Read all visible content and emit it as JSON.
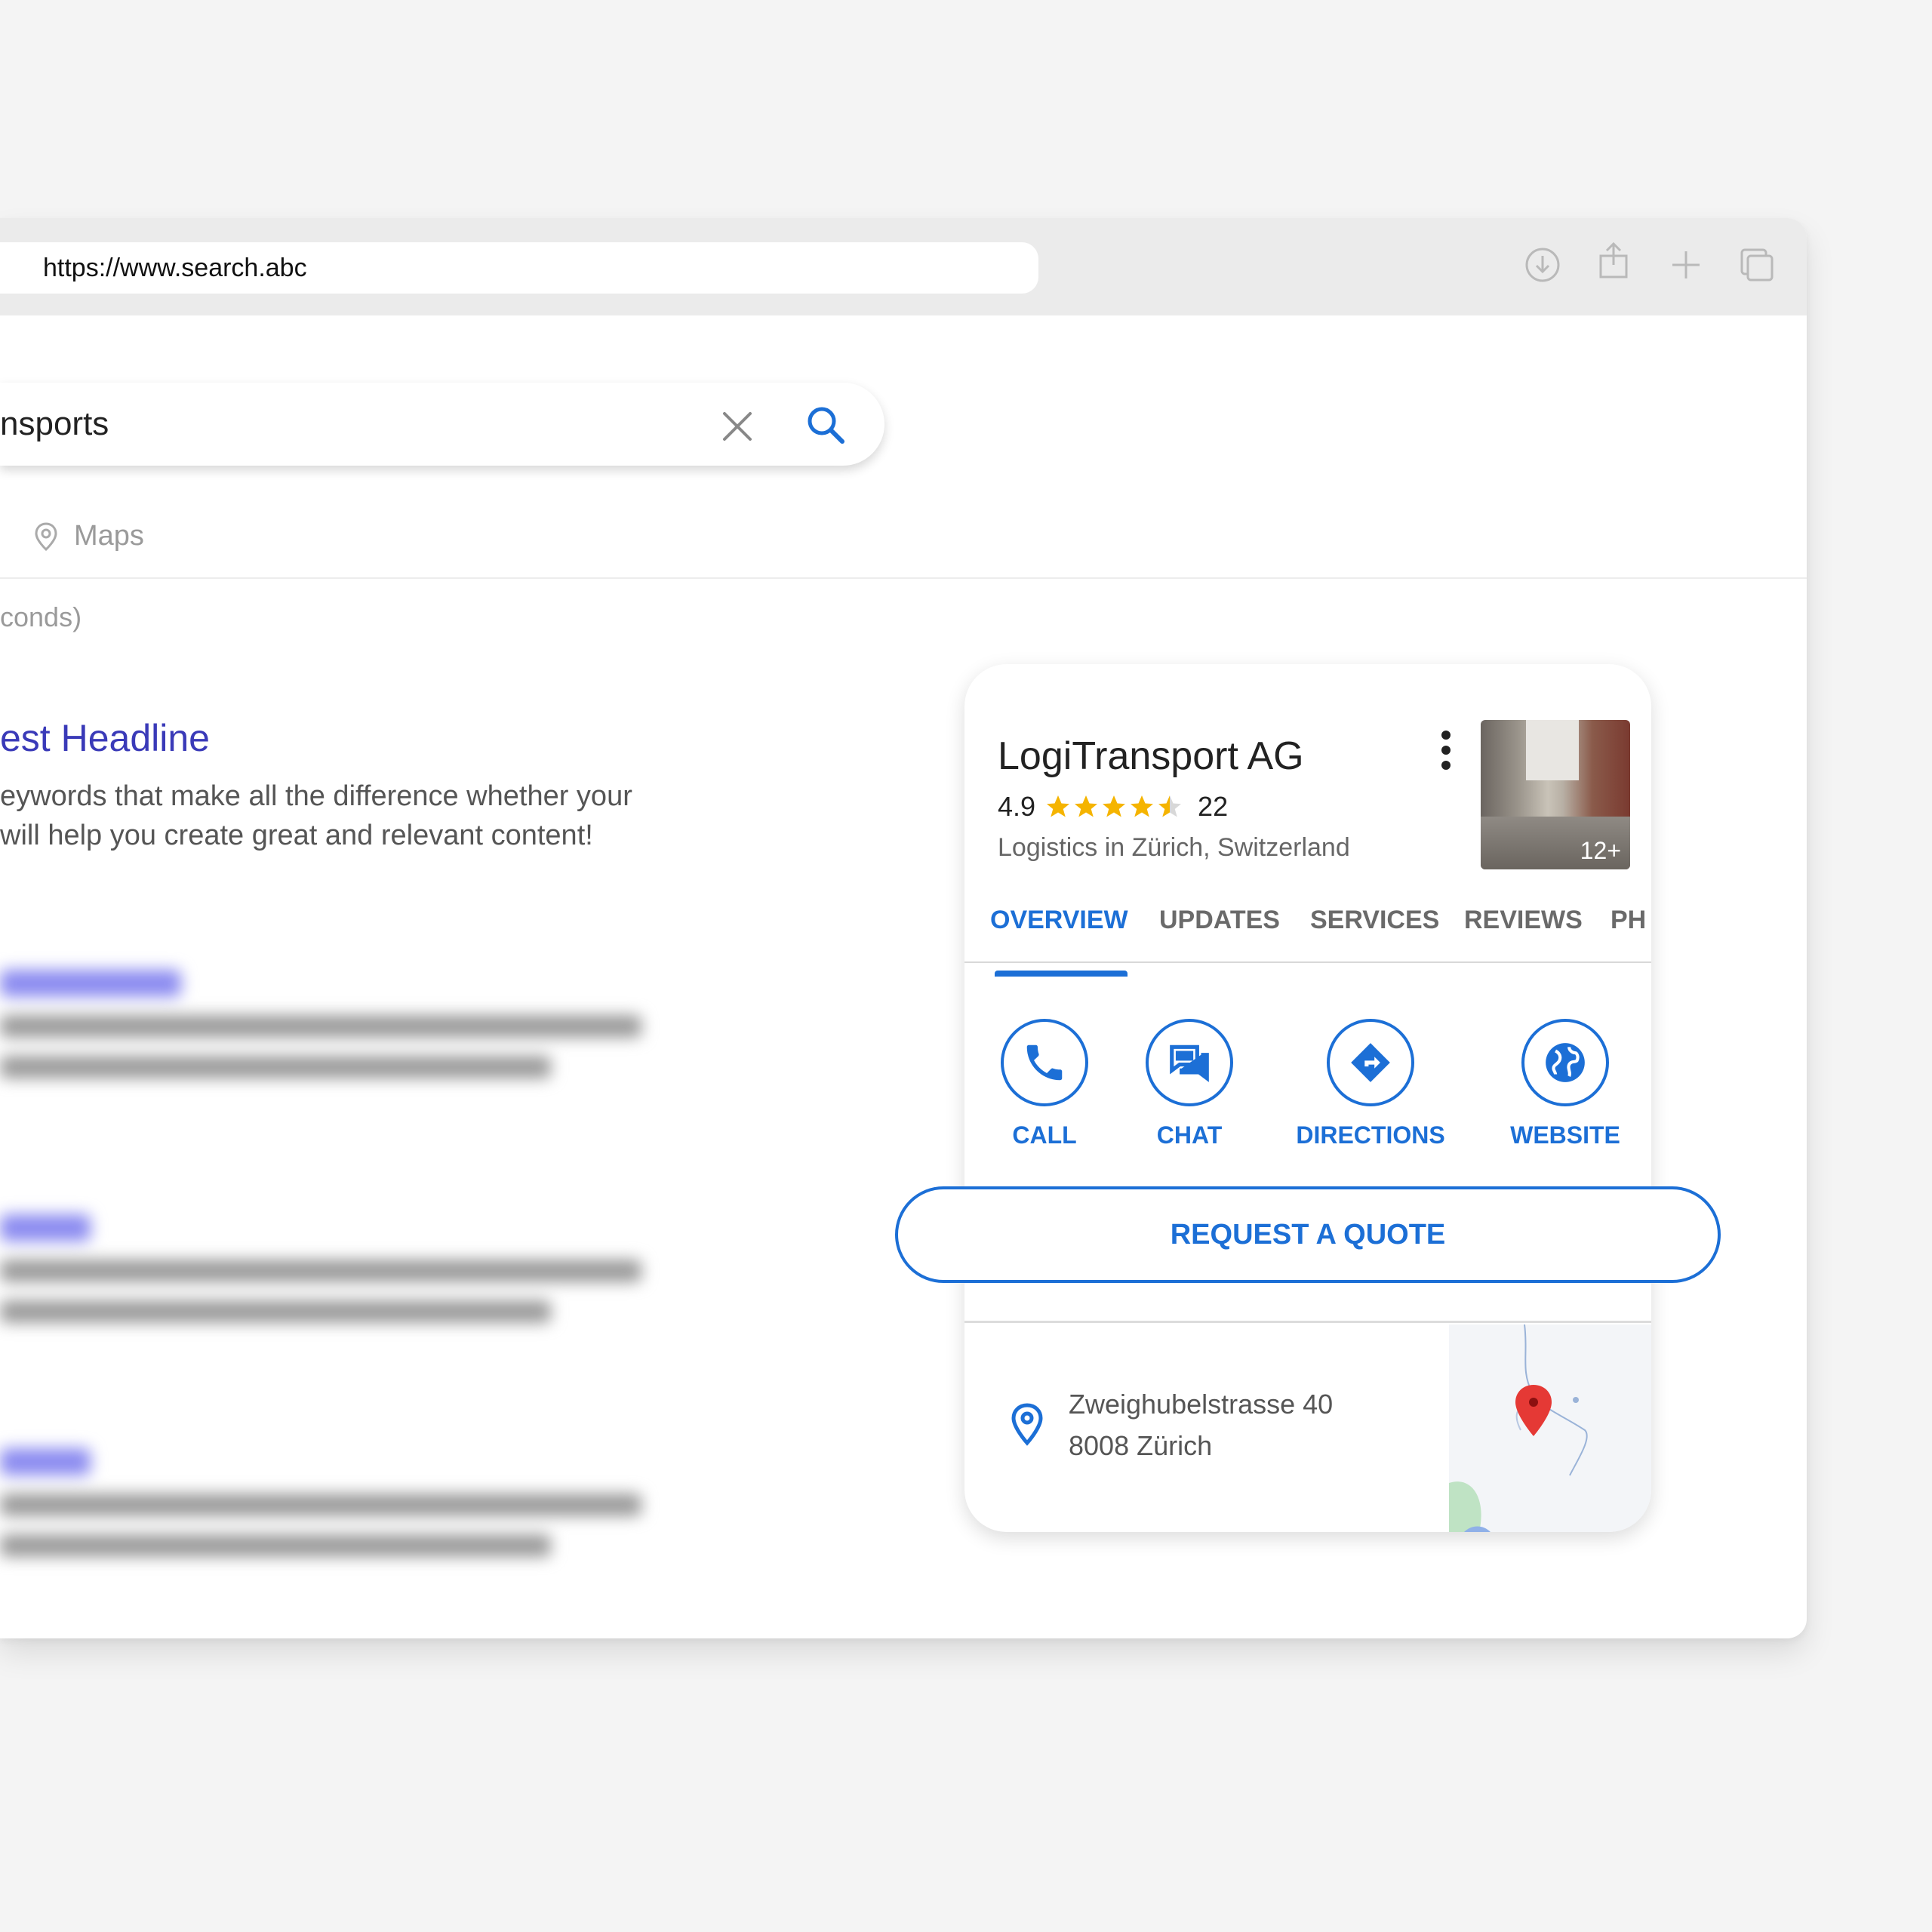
{
  "browser": {
    "url": "https://www.search.abc",
    "icons": [
      "download-icon",
      "share-icon",
      "new-tab-icon",
      "tabs-icon"
    ]
  },
  "search": {
    "query_visible": "nsports",
    "clear_icon": "close-icon",
    "submit_icon": "search-icon"
  },
  "nav": {
    "maps_label": "Maps"
  },
  "results": {
    "stats_fragment": "conds)",
    "first": {
      "title": "est Headline",
      "snippet_line1": "eywords that make all the difference whether your",
      "snippet_line2": " will help you create great and relevant content!"
    }
  },
  "business": {
    "name": "LogiTransport AG",
    "rating": "4.9",
    "review_count": "22",
    "stars": 4.5,
    "category": "Logistics in Zürich, Switzerland",
    "photo_count": "12+",
    "tabs": [
      {
        "label": "OVERVIEW",
        "active": true
      },
      {
        "label": "UPDATES",
        "active": false
      },
      {
        "label": "SERVICES",
        "active": false
      },
      {
        "label": "REVIEWS",
        "active": false
      },
      {
        "label": "PH",
        "active": false
      }
    ],
    "actions": [
      {
        "label": "CALL",
        "icon": "phone-icon"
      },
      {
        "label": "CHAT",
        "icon": "chat-icon"
      },
      {
        "label": "DIRECTIONS",
        "icon": "directions-icon"
      },
      {
        "label": "WEBSITE",
        "icon": "globe-icon"
      }
    ],
    "quote_label": "REQUEST A QUOTE",
    "address_line1": "Zweighubelstrasse 40",
    "address_line2": "8008 Zürich"
  },
  "colors": {
    "accent": "#1c6fd6",
    "link": "#3a3ab8",
    "star": "#f5b400",
    "map_pin": "#e53935",
    "background": "#f4f4f4"
  }
}
